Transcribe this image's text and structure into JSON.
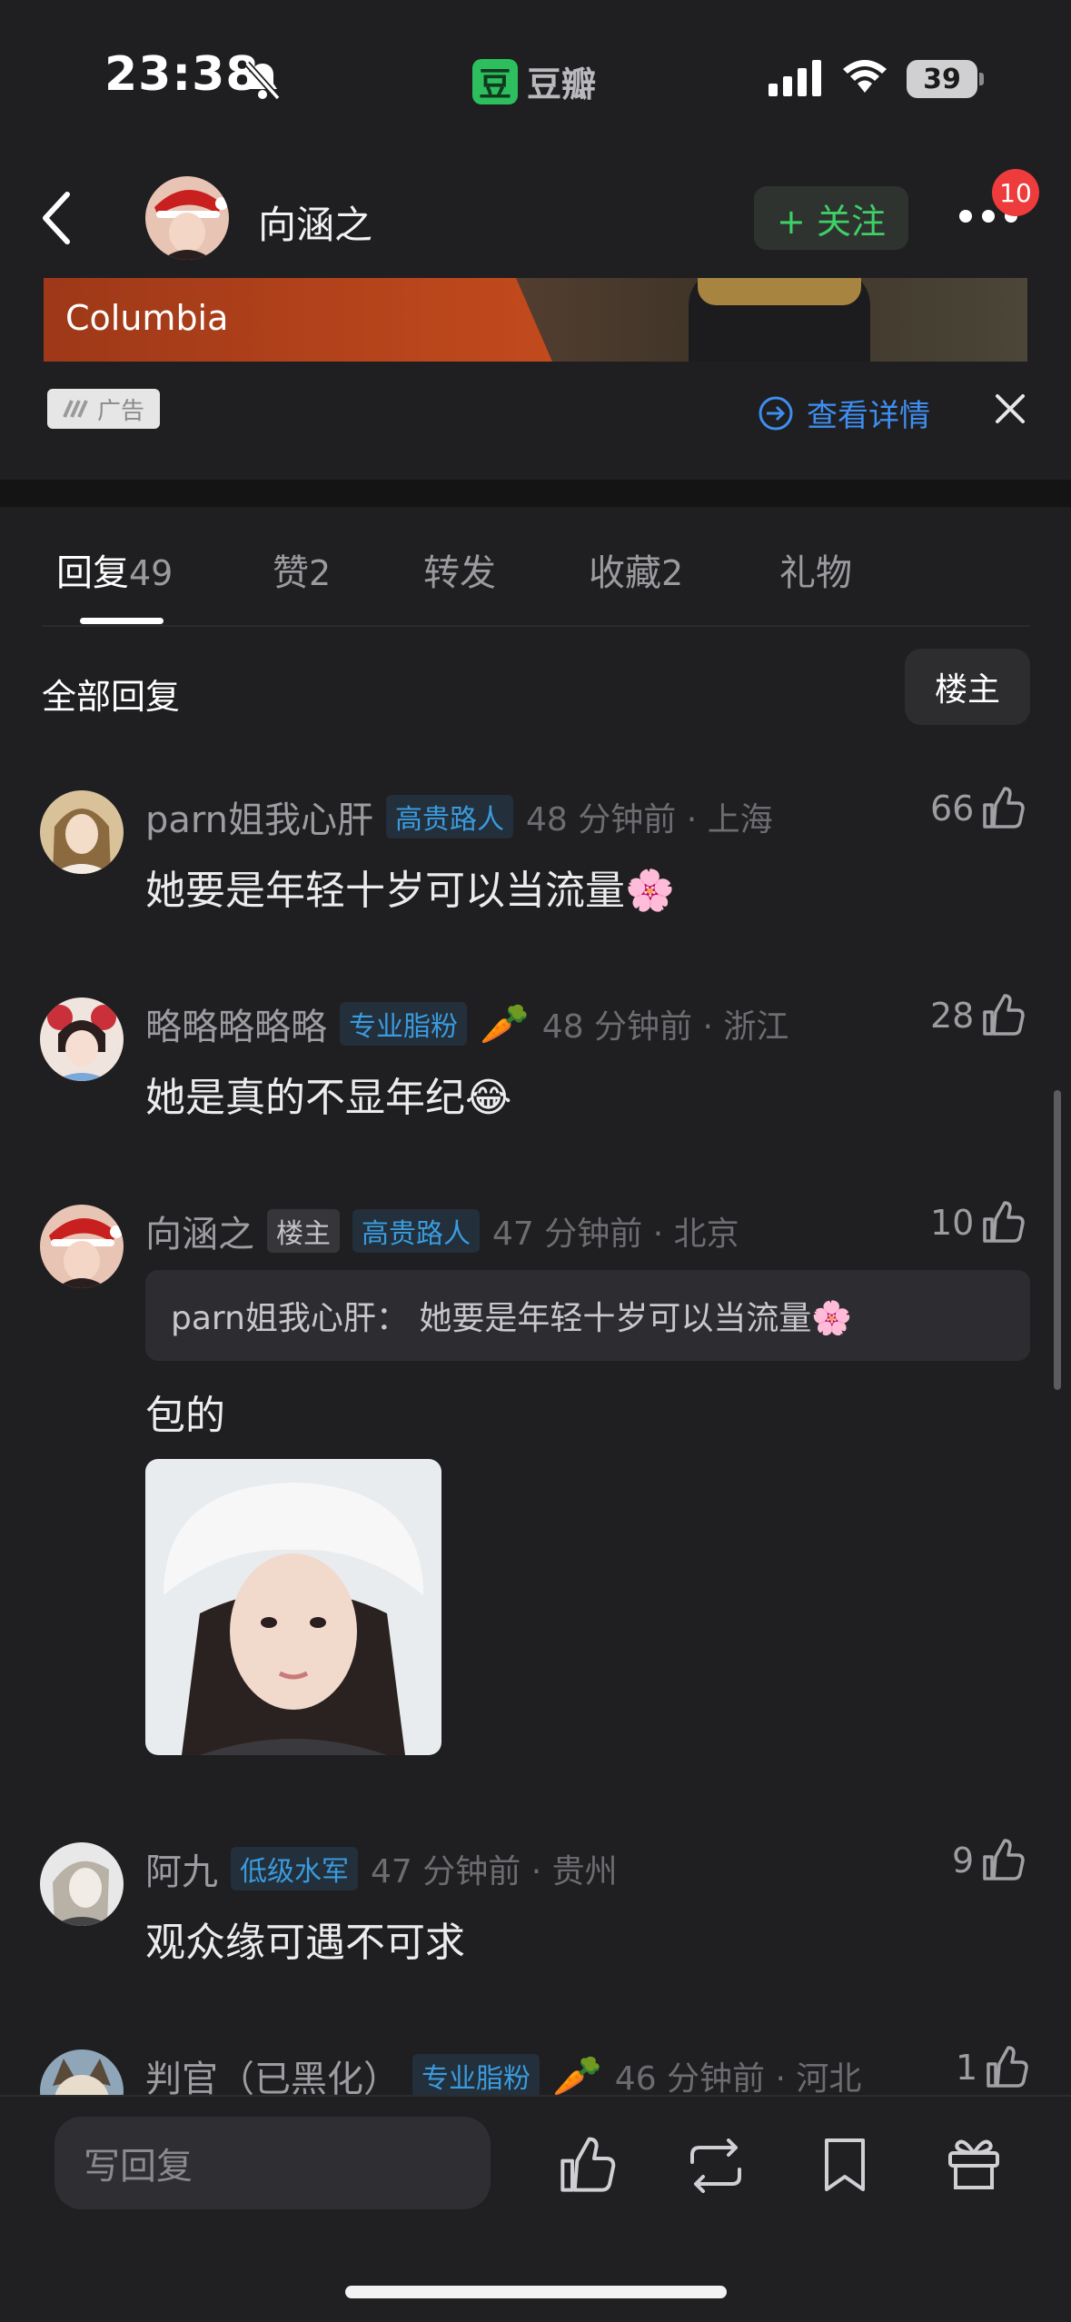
{
  "status_bar": {
    "time": "23:38",
    "app_logo": "豆",
    "app_name": "豆瓣",
    "battery": "39"
  },
  "header": {
    "name": "向涵之",
    "follow_label": "+ 关注",
    "notification_count": "10"
  },
  "ad": {
    "brand": "Columbia",
    "tag": "广告",
    "detail_label": "查看详情"
  },
  "tabs": [
    {
      "label": "回复",
      "count": "49"
    },
    {
      "label": "赞",
      "count": "2"
    },
    {
      "label": "转发",
      "count": ""
    },
    {
      "label": "收藏",
      "count": "2"
    },
    {
      "label": "礼物",
      "count": ""
    }
  ],
  "filter": {
    "all_label": "全部回复",
    "op_label": "楼主"
  },
  "comments": [
    {
      "name": "parn姐我心肝",
      "badge": "高贵路人",
      "meta": "48 分钟前 · 上海",
      "likes": "66",
      "text": "她要是年轻十岁可以当流量🌸"
    },
    {
      "name": "略略略略略",
      "badge": "专业脂粉",
      "emoji": "🥕",
      "meta": "48 分钟前 · 浙江",
      "likes": "28",
      "text": "她是真的不显年纪😂"
    },
    {
      "name": "向涵之",
      "op_badge": "楼主",
      "badge": "高贵路人",
      "meta": "47 分钟前 · 北京",
      "likes": "10",
      "quote": "parn姐我心肝：  她要是年轻十岁可以当流量🌸",
      "text": "包的"
    },
    {
      "name": "阿九",
      "badge": "低级水军",
      "meta": "47 分钟前 · 贵州",
      "likes": "9",
      "text": "观众缘可遇不可求"
    },
    {
      "name": "判官（已黑化）",
      "badge": "专业脂粉",
      "emoji": "🥕",
      "meta": "46 分钟前 · 河北",
      "likes": "1"
    }
  ],
  "bottom_bar": {
    "reply_placeholder": "写回复"
  },
  "colors": {
    "background": "#1f1f21",
    "accent_green": "#3fcf67",
    "link_blue": "#3e8ef0",
    "badge_blue": "#3a9bde",
    "notification_red": "#ee3b3b"
  }
}
